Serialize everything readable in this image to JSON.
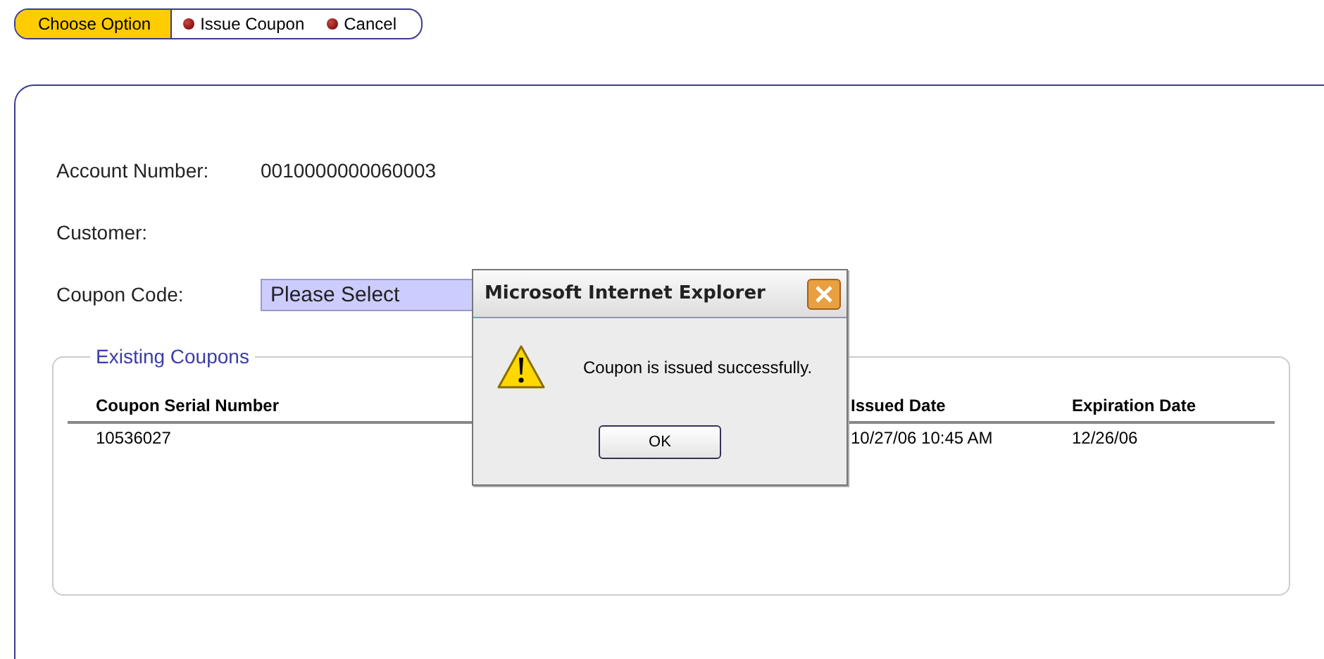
{
  "toolbar": [
    {
      "kind": "label",
      "text": "Choose Option"
    },
    {
      "kind": "action",
      "text": "Issue Coupon"
    },
    {
      "kind": "action",
      "text": "Cancel"
    }
  ],
  "form": {
    "fields": [
      {
        "kind": "text",
        "label": "Account Number:",
        "value": "0010000000060003"
      },
      {
        "kind": "text",
        "label": "Customer:"
      },
      {
        "kind": "select",
        "label": "Coupon Code:",
        "value": "Please Select"
      }
    ]
  },
  "existing_coupons": {
    "title": "Existing Coupons",
    "columns": [
      "Coupon Serial Number",
      "Issued Date",
      "Expiration Date"
    ],
    "rows": [
      [
        "10536027",
        "10/27/06 10:45 AM",
        "12/26/06"
      ]
    ]
  },
  "dialog": {
    "title": "Microsoft Internet Explorer",
    "message": "Coupon is issued successfully.",
    "buttons": [
      "OK"
    ]
  }
}
